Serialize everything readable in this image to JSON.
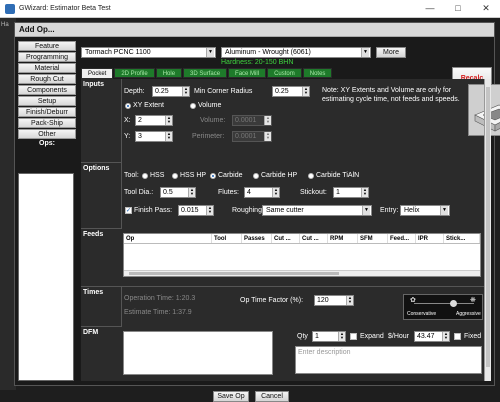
{
  "os_window": {
    "title": "GWizard: Estimator Beta Test",
    "bg_tab": "Ha"
  },
  "dialog": {
    "title": "Add Op..."
  },
  "sidebar": {
    "items": [
      "Feature",
      "Programming",
      "Material",
      "Rough Cut",
      "Components",
      "Setup",
      "Finish/Deburr",
      "Pack-Ship",
      "Other"
    ],
    "ops_label": "Ops:"
  },
  "topbar": {
    "machine": "Tormach PCNC 1100",
    "material": "Aluminum - Wrought (6061)",
    "more_label": "More",
    "hardness": "Hardness: 20-150 BHN",
    "recalc_label": "Recalc"
  },
  "tabs": [
    "Pocket",
    "2D Profile",
    "Hole",
    "3D Surface",
    "Face Mill",
    "Custom",
    "Notes"
  ],
  "inputs": {
    "label": "Inputs",
    "depth_label": "Depth:",
    "depth": "0.25",
    "min_corner_label": "Min Corner Radius",
    "min_corner": "0.25",
    "xy_extent_label": "XY Extent",
    "volume_label": "Volume",
    "x_label": "X:",
    "x": "2",
    "y_label": "Y:",
    "y": "3",
    "volume_field_label": "Volume:",
    "volume": "0.0001",
    "perimeter_label": "Perimeter:",
    "perimeter": "0.0001",
    "note": "Note: XY Extents and Volume are only for estimating cycle time, not feeds and speeds."
  },
  "options": {
    "label": "Options",
    "tool_label": "Tool:",
    "tool_types": [
      "HSS",
      "HSS HP",
      "Carbide",
      "Carbide HP",
      "Carbide TiAlN"
    ],
    "tool_dia_label": "Tool Dia.:",
    "tool_dia": "0.5",
    "flutes_label": "Flutes:",
    "flutes": "4",
    "stickout_label": "Stickout:",
    "stickout": "1",
    "finish_pass_label": "Finish Pass:",
    "finish_pass": "0.015",
    "roughing_label": "Roughing",
    "roughing": "Same cutter",
    "entry_label": "Entry:",
    "entry": "Helix"
  },
  "feeds": {
    "label": "Feeds",
    "columns": [
      "Op",
      "Tool",
      "Passes",
      "Cut ...",
      "Cut ...",
      "RPM",
      "SFM",
      "Feed...",
      "IPR",
      "Stick..."
    ]
  },
  "times": {
    "label": "Times",
    "operation_time": "Operation Time: 1:20.3",
    "estimate_time": "Estimate Time:   1:37.9",
    "op_time_factor_label": "Op Time Factor (%):",
    "op_time_factor": "120",
    "conservative_label": "Conservative",
    "aggressive_label": "Aggressive",
    "aggressiveness": 0.65
  },
  "dfm": {
    "label": "DFM",
    "qty_label": "Qty",
    "qty": "1",
    "expand_label": "Expand",
    "per_hour_label": "$/Hour",
    "per_hour": "43.47",
    "fixed_label": "Fixed",
    "description_placeholder": "Enter description"
  },
  "footer": {
    "save_label": "Save Op",
    "cancel_label": "Cancel"
  }
}
